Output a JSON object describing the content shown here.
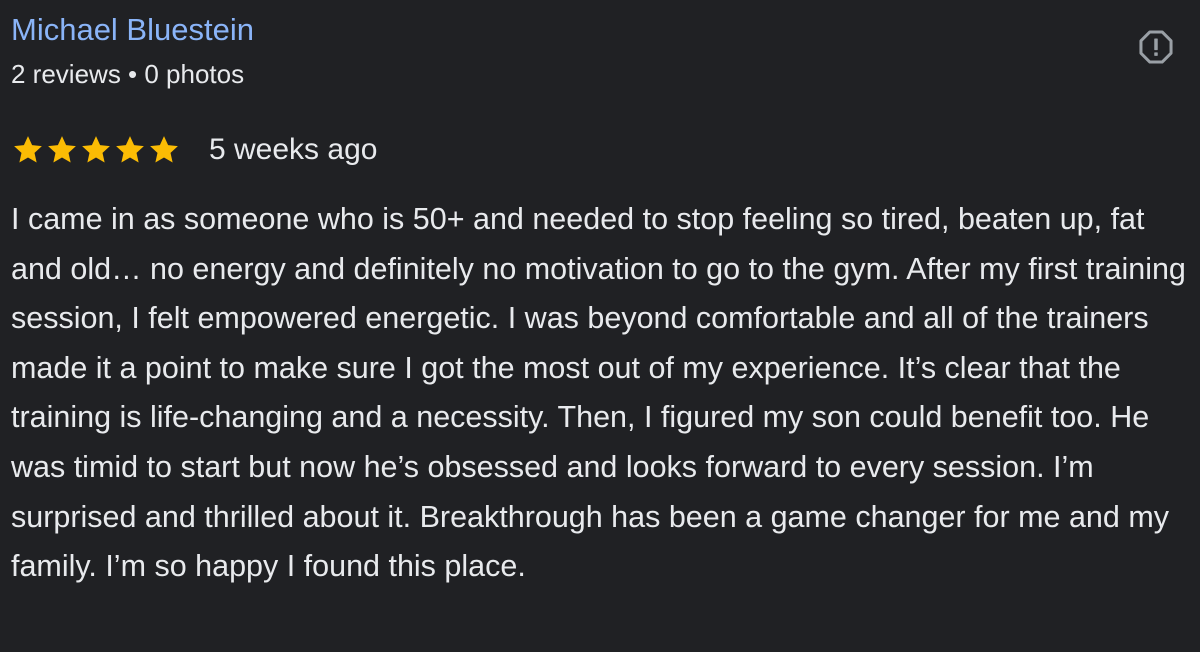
{
  "review": {
    "reviewer_name": "Michael Bluestein",
    "reviewer_meta": "2 reviews • 0 photos",
    "rating": 5,
    "rating_max": 5,
    "date": "5 weeks ago",
    "text": "I came in as someone who is 50+ and needed to stop feeling so tired, beaten up, fat and old… no energy and definitely no motivation to go to the gym. After my first training session, I felt empowered energetic. I was beyond comfortable and all of the trainers made it a point to make sure I got the most out of my experience. It’s clear that the training is life-changing and a necessity. Then, I figured my son could benefit too. He was timid to start but now he’s obsessed and looks forward to every session. I’m surprised and thrilled about it. Breakthrough has been a game changer for me and my family. I’m so happy I found this place."
  },
  "icons": {
    "report": "report-flag-icon",
    "star": "star-icon"
  },
  "colors": {
    "background": "#202124",
    "name": "#8ab4f8",
    "text": "#e8eaed",
    "star": "#fbbc04",
    "icon": "#9aa0a6"
  }
}
